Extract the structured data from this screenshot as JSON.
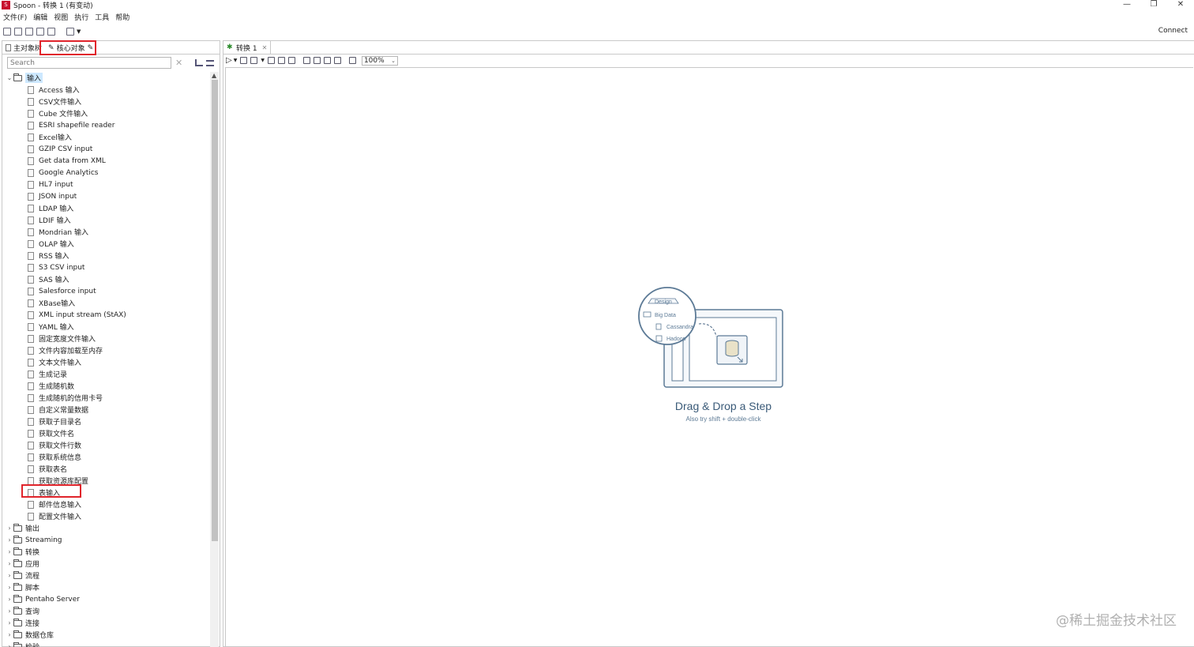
{
  "window": {
    "title": "Spoon - 转换 1 (有变动)",
    "app_icon_label": "S",
    "controls": [
      "—",
      "❐",
      "✕"
    ]
  },
  "menubar": [
    "文件(F)",
    "编辑",
    "视图",
    "执行",
    "工具",
    "帮助"
  ],
  "toolbar": {
    "connect_label": "Connect"
  },
  "left_panel": {
    "tabs": [
      {
        "label": "主对象树"
      },
      {
        "label": "核心对象"
      }
    ],
    "search": {
      "placeholder": "Search"
    },
    "tree": {
      "input_folder": "输入",
      "input_steps": [
        "Access 输入",
        "CSV文件输入",
        "Cube 文件输入",
        "ESRI shapefile reader",
        "Excel输入",
        "GZIP CSV input",
        "Get data from XML",
        "Google Analytics",
        "HL7 input",
        "JSON input",
        "LDAP 输入",
        "LDIF 输入",
        "Mondrian 输入",
        "OLAP 输入",
        "RSS 输入",
        "S3 CSV input",
        "SAS 输入",
        "Salesforce input",
        "XBase输入",
        "XML input stream (StAX)",
        "YAML 输入",
        "固定宽度文件输入",
        "文件内容加载至内存",
        "文本文件输入",
        "生成记录",
        "生成随机数",
        "生成随机的信用卡号",
        "自定义常量数据",
        "获取子目录名",
        "获取文件名",
        "获取文件行数",
        "获取系统信息",
        "获取表名",
        "获取资源库配置",
        "表输入",
        "邮件信息输入",
        "配置文件输入"
      ],
      "other_folders": [
        "输出",
        "Streaming",
        "转换",
        "应用",
        "流程",
        "脚本",
        "Pentaho Server",
        "查询",
        "连接",
        "数据仓库",
        "检验"
      ]
    }
  },
  "editor": {
    "tab_label": "转换 1",
    "zoom": "100%",
    "empty_state": {
      "title": "Drag & Drop a Step",
      "subtitle": "Also try shift + double-click",
      "illustration": {
        "tab": "Design",
        "folder": "Big Data",
        "item1": "Cassandra",
        "item2": "Hadoop"
      }
    }
  },
  "watermark": "@稀土掘金技术社区"
}
